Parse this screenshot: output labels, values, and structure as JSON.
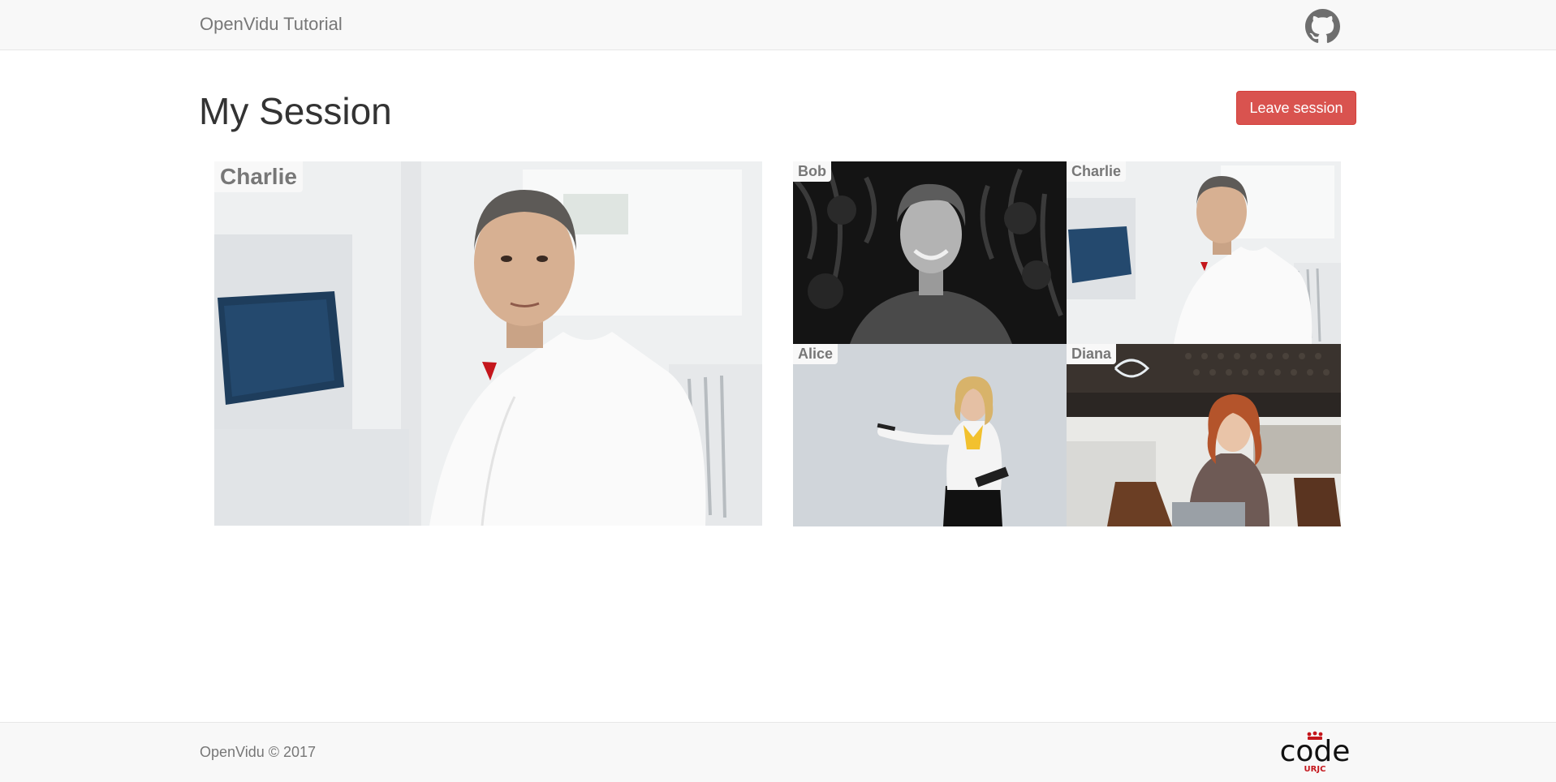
{
  "navbar": {
    "brand": "OpenVidu Tutorial",
    "github_icon": "github-icon"
  },
  "session": {
    "title": "My Session",
    "leave_label": "Leave session"
  },
  "main_video": {
    "name": "Charlie"
  },
  "participants": [
    {
      "name": "Bob"
    },
    {
      "name": "Charlie"
    },
    {
      "name": "Alice"
    },
    {
      "name": "Diana"
    }
  ],
  "footer": {
    "copyright": "OpenVidu © 2017",
    "logo_text": "code",
    "logo_subtext": "URJC"
  },
  "colors": {
    "leave": "#d9534f",
    "navbar_bg": "#f8f8f8",
    "muted_text": "#777777",
    "logo_red": "#c4161c"
  }
}
